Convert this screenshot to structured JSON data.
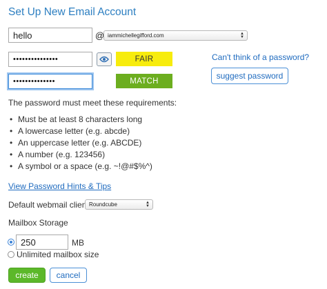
{
  "title": "Set Up New Email Account",
  "username": {
    "value": "hello"
  },
  "at_sign": "@",
  "domain_select": {
    "selected": "iammichellegifford.com"
  },
  "password": {
    "masked": "•••••••••••••••"
  },
  "confirm_password": {
    "masked": "••••••••••••••"
  },
  "strength_badge": {
    "label": "FAIR",
    "color": "#f7ec0d"
  },
  "match_badge": {
    "label": "MATCH",
    "color": "#6cae1f"
  },
  "cant_think_link": "Can't think of a password?",
  "suggest_button": "suggest password",
  "requirements": {
    "heading": "The password must meet these requirements:",
    "items": [
      "Must be at least 8 characters long",
      "A lowercase letter (e.g. abcde)",
      "An uppercase letter (e.g. ABCDE)",
      "A number (e.g. 123456)",
      "A symbol or a space (e.g. ~!@#$%^)"
    ]
  },
  "hints_link": "View Password Hints & Tips",
  "webmail": {
    "label": "Default webmail client",
    "selected": "Roundcube"
  },
  "storage": {
    "label": "Mailbox Storage",
    "value": "250",
    "unit": "MB",
    "unlimited_label": "Unlimited mailbox size",
    "selected_option": "limited"
  },
  "buttons": {
    "create": "create",
    "cancel": "cancel"
  },
  "colors": {
    "accent": "#2d7fc1",
    "link": "#1f6bbf",
    "create": "#5cb82a"
  }
}
